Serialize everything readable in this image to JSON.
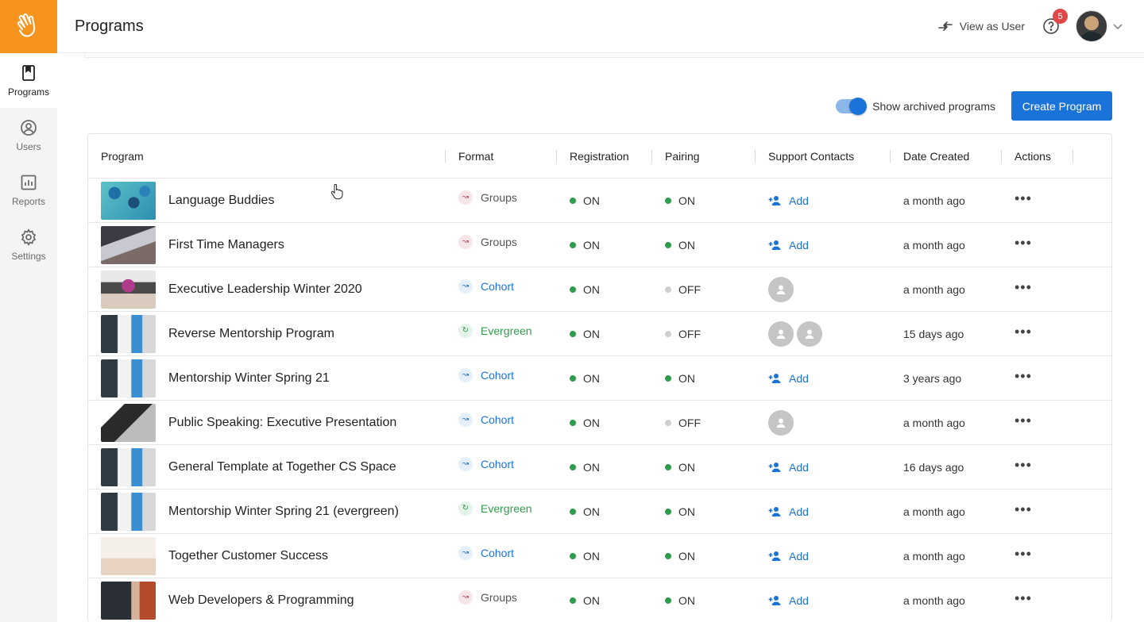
{
  "sidebar": {
    "items": [
      {
        "label": "Programs",
        "icon": "bookmark-icon"
      },
      {
        "label": "Users",
        "icon": "user-circle-icon"
      },
      {
        "label": "Reports",
        "icon": "chart-icon"
      },
      {
        "label": "Settings",
        "icon": "gear-icon"
      }
    ]
  },
  "header": {
    "title": "Programs",
    "view_as_user": "View as User",
    "help_badge": "5"
  },
  "toolbar": {
    "archived_label": "Show archived programs",
    "archived_on": true,
    "create_label": "Create Program"
  },
  "table": {
    "columns": [
      "Program",
      "Format",
      "Registration",
      "Pairing",
      "Support Contacts",
      "Date Created",
      "Actions"
    ],
    "rows": [
      {
        "name": "Language Buddies",
        "format": "Groups",
        "registration": "ON",
        "pairing": "ON",
        "support": "Add",
        "date": "a month ago"
      },
      {
        "name": "First Time Managers",
        "format": "Groups",
        "registration": "ON",
        "pairing": "ON",
        "support": "Add",
        "date": "a month ago"
      },
      {
        "name": "Executive Leadership Winter 2020",
        "format": "Cohort",
        "registration": "ON",
        "pairing": "OFF",
        "support": "",
        "date": "a month ago"
      },
      {
        "name": "Reverse Mentorship Program",
        "format": "Evergreen",
        "registration": "ON",
        "pairing": "OFF",
        "support": "",
        "date": "15 days ago"
      },
      {
        "name": "Mentorship Winter Spring 21",
        "format": "Cohort",
        "registration": "ON",
        "pairing": "ON",
        "support": "Add",
        "date": "3 years ago"
      },
      {
        "name": "Public Speaking: Executive Presentation",
        "format": "Cohort",
        "registration": "ON",
        "pairing": "OFF",
        "support": "",
        "date": "a month ago"
      },
      {
        "name": "General Template at Together CS Space",
        "format": "Cohort",
        "registration": "ON",
        "pairing": "ON",
        "support": "Add",
        "date": "16 days ago"
      },
      {
        "name": "Mentorship Winter Spring 21 (evergreen)",
        "format": "Evergreen",
        "registration": "ON",
        "pairing": "ON",
        "support": "Add",
        "date": "a month ago"
      },
      {
        "name": "Together Customer Success",
        "format": "Cohort",
        "registration": "ON",
        "pairing": "ON",
        "support": "Add",
        "date": "a month ago"
      },
      {
        "name": "Web Developers & Programming",
        "format": "Groups",
        "registration": "ON",
        "pairing": "ON",
        "support": "Add",
        "date": "a month ago"
      }
    ],
    "actions_glyph": "•••"
  },
  "colors": {
    "brand_orange": "#f7941d",
    "primary_blue": "#1a73d9",
    "status_on": "#2e9e4d",
    "status_off": "#cfcfcf",
    "format_groups": "#555555",
    "format_cohort": "#1a73d9",
    "format_evergreen": "#2e9e4d"
  }
}
